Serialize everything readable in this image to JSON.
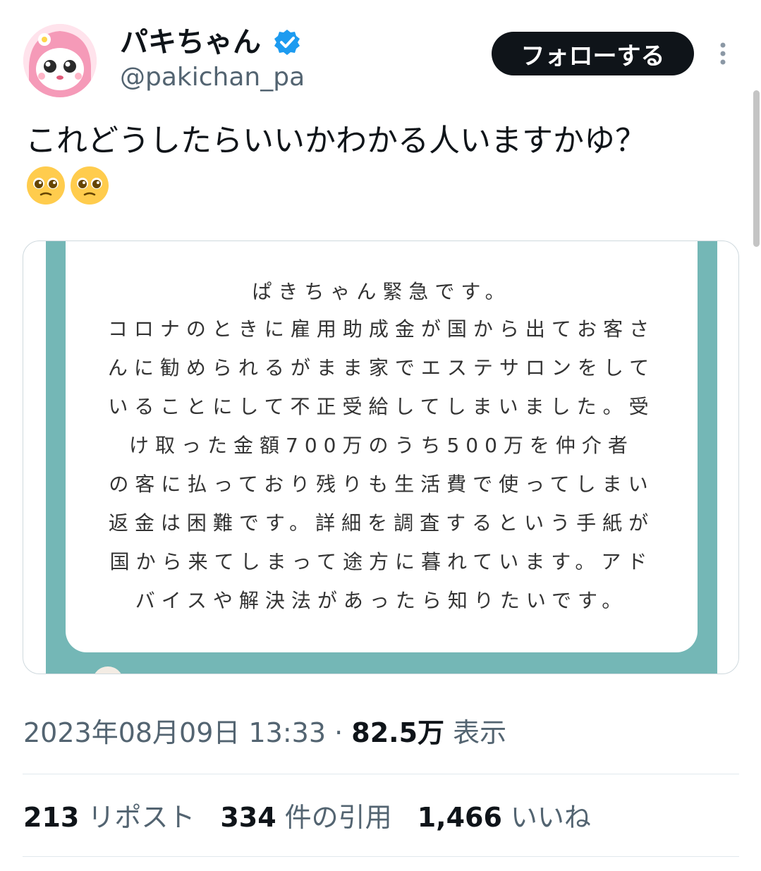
{
  "user": {
    "display_name": "パキちゃん",
    "handle": "@pakichan_pa",
    "verified_icon": "verified-badge-icon",
    "follow_label": "フォローする",
    "more_icon": "more-vertical-icon"
  },
  "tweet": {
    "text": "これどうしたらいいかわかる人いますかゆ？",
    "emojis": [
      "pleading-face-emoji",
      "pleading-face-emoji"
    ]
  },
  "image_note": {
    "lines": [
      "ぱきちゃん緊急です。",
      "コロナのときに雇用助成金が国から出てお客さ",
      "んに勧められるがまま家でエステサロンをして",
      "いることにして不正受給してしまいました。受",
      "け取った金額700万のうち500万を仲介者",
      "の客に払っており残りも生活費で使ってしまい",
      "返金は困難です。詳細を調査するという手紙が",
      "国から来てしまって途方に暮れています。アド",
      "バイスや解決法があったら知りたいです。"
    ]
  },
  "meta": {
    "timestamp": "2023年08月09日 13:33",
    "separator": "·",
    "views_count": "82.5万",
    "views_label": "表示"
  },
  "stats": {
    "reposts_count": "213",
    "reposts_label": "リポスト",
    "quotes_count": "334",
    "quotes_label": "件の引用",
    "likes_count": "1,466",
    "likes_label": "いいね"
  },
  "colors": {
    "text_primary": "#0f1419",
    "text_secondary": "#536471",
    "verified_blue": "#1d9bf0",
    "image_teal": "#74b7b6",
    "follow_bg": "#0f1419"
  }
}
